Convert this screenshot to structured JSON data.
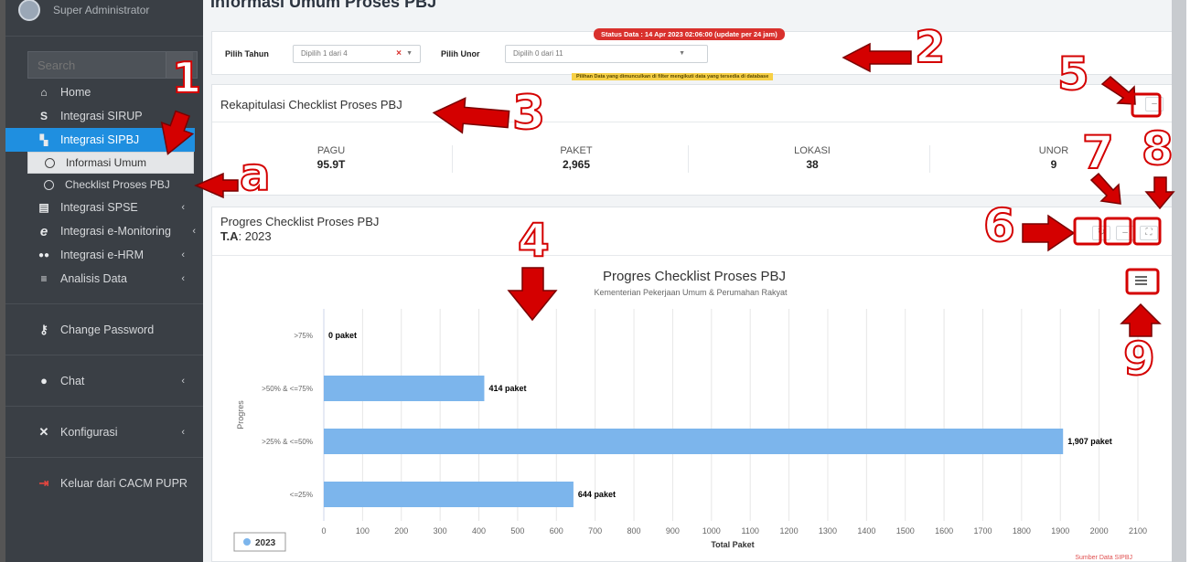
{
  "sidebar": {
    "username": "Super Administrator",
    "search_placeholder": "Search",
    "items": [
      {
        "label": "Home",
        "icon": "home-icon",
        "glyph": "⌂"
      },
      {
        "label": "Integrasi SIRUP",
        "icon": "s-icon",
        "glyph": "S"
      },
      {
        "label": "Integrasi SIPBJ",
        "icon": "cart-icon",
        "glyph": "🛒"
      }
    ],
    "subitems": [
      {
        "label": "Informasi Umum"
      },
      {
        "label": "Checklist Proses PBJ"
      }
    ],
    "items2": [
      {
        "label": "Integrasi SPSE",
        "icon": "building-icon",
        "glyph": "▤"
      },
      {
        "label": "Integrasi e-Monitoring",
        "icon": "e-icon",
        "glyph": "e"
      },
      {
        "label": "Integrasi e-HRM",
        "icon": "users-icon",
        "glyph": "👥"
      },
      {
        "label": "Analisis Data",
        "icon": "database-icon",
        "glyph": "≡"
      }
    ],
    "blocks": [
      {
        "label": "Change Password",
        "icon": "key-icon",
        "glyph": "🔑"
      },
      {
        "label": "Chat",
        "icon": "chat-icon",
        "glyph": "💬"
      },
      {
        "label": "Konfigurasi",
        "icon": "tools-icon",
        "glyph": "✕"
      },
      {
        "label": "Keluar dari CACM PUPR",
        "icon": "logout-icon",
        "glyph": "⇥"
      }
    ],
    "chevron": "‹"
  },
  "main": {
    "page_title": "Informasi Umum Proses PBJ",
    "filter": {
      "status": "Status Data : 14 Apr 2023 02:06:00 (update per 24 jam)",
      "tahun_label": "Pilih Tahun",
      "tahun_value": "Dipilih 1 dari 4",
      "unor_label": "Pilih Unor",
      "unor_value": "Dipilih 0 dari 11",
      "note": "Pilihan Data yang dimunculkan di filter mengikuti data yang tersedia di database"
    },
    "recap": {
      "title": "Rekapitulasi Checklist Proses PBJ",
      "stats": [
        {
          "label": "PAGU",
          "value": "95.9T"
        },
        {
          "label": "PAKET",
          "value": "2,965"
        },
        {
          "label": "LOKASI",
          "value": "38"
        },
        {
          "label": "UNOR",
          "value": "9"
        }
      ]
    },
    "progress": {
      "title": "Progres Checklist Proses PBJ",
      "ta_label": "T.A",
      "ta_value": ": 2023"
    }
  },
  "chart_data": {
    "type": "bar",
    "orientation": "horizontal",
    "title": "Progres Checklist Proses PBJ",
    "subtitle": "Kementerian Pekerjaan Umum & Perumahan Rakyat",
    "categories": [
      ">75%",
      ">50% & <=75%",
      ">25% & <=50%",
      "<=25%"
    ],
    "series": [
      {
        "name": "2023",
        "values": [
          0,
          414,
          1907,
          644
        ],
        "color": "#7cb5ec"
      }
    ],
    "data_labels": [
      "0 paket",
      "414 paket",
      "1,907 paket",
      "644 paket"
    ],
    "xlabel": "Total Paket",
    "ylabel": "Progres",
    "xlim": [
      0,
      2100
    ],
    "xticks": [
      0,
      100,
      200,
      300,
      400,
      500,
      600,
      700,
      800,
      900,
      1000,
      1100,
      1200,
      1300,
      1400,
      1500,
      1600,
      1700,
      1800,
      1900,
      2000,
      2100
    ],
    "grid": true,
    "legend": "bottom-left",
    "credit": "Sumber Data SIPBJ"
  },
  "annotations": [
    "1",
    "2",
    "3",
    "4",
    "5",
    "6",
    "7",
    "8",
    "9",
    "a"
  ],
  "colors": {
    "accent": "#1f8fe0",
    "annotation": "#d40000",
    "bar": "#7cb5ec"
  }
}
